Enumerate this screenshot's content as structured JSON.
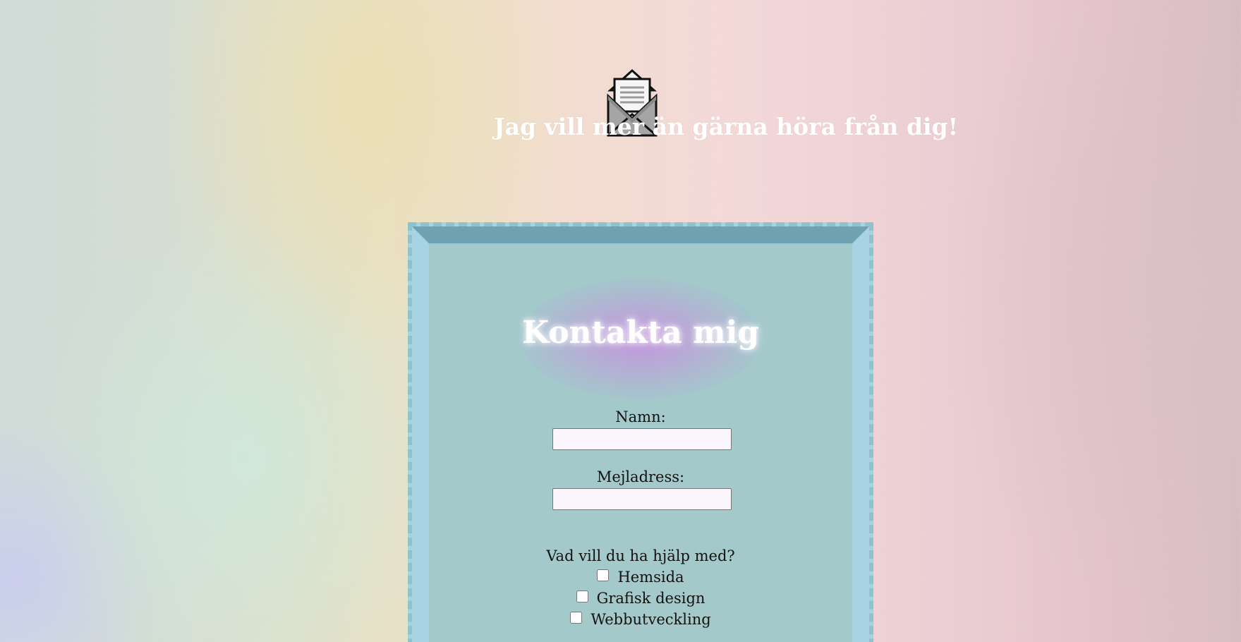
{
  "hero": {
    "icon": "open-envelope-letter-icon",
    "title": "Jag vill mer än gärna höra från dig!"
  },
  "form": {
    "title": "Kontakta mig",
    "name_label": "Namn:",
    "name_value": "",
    "email_label": "Mejladress:",
    "email_value": "",
    "help_question": "Vad vill du ha hjälp med?",
    "options": [
      {
        "label": "Hemsida",
        "checked": false
      },
      {
        "label": "Grafisk design",
        "checked": false
      },
      {
        "label": "Webbutveckling",
        "checked": false
      }
    ]
  },
  "colors": {
    "panel_border": "#8fc3cc",
    "panel_bevel_top": "#6ea2b2",
    "panel_bevel_side": "#a8d3e3",
    "panel_body": "#a4c9cb",
    "title_glow": "#c88ce1",
    "text_white": "#ffffff"
  }
}
